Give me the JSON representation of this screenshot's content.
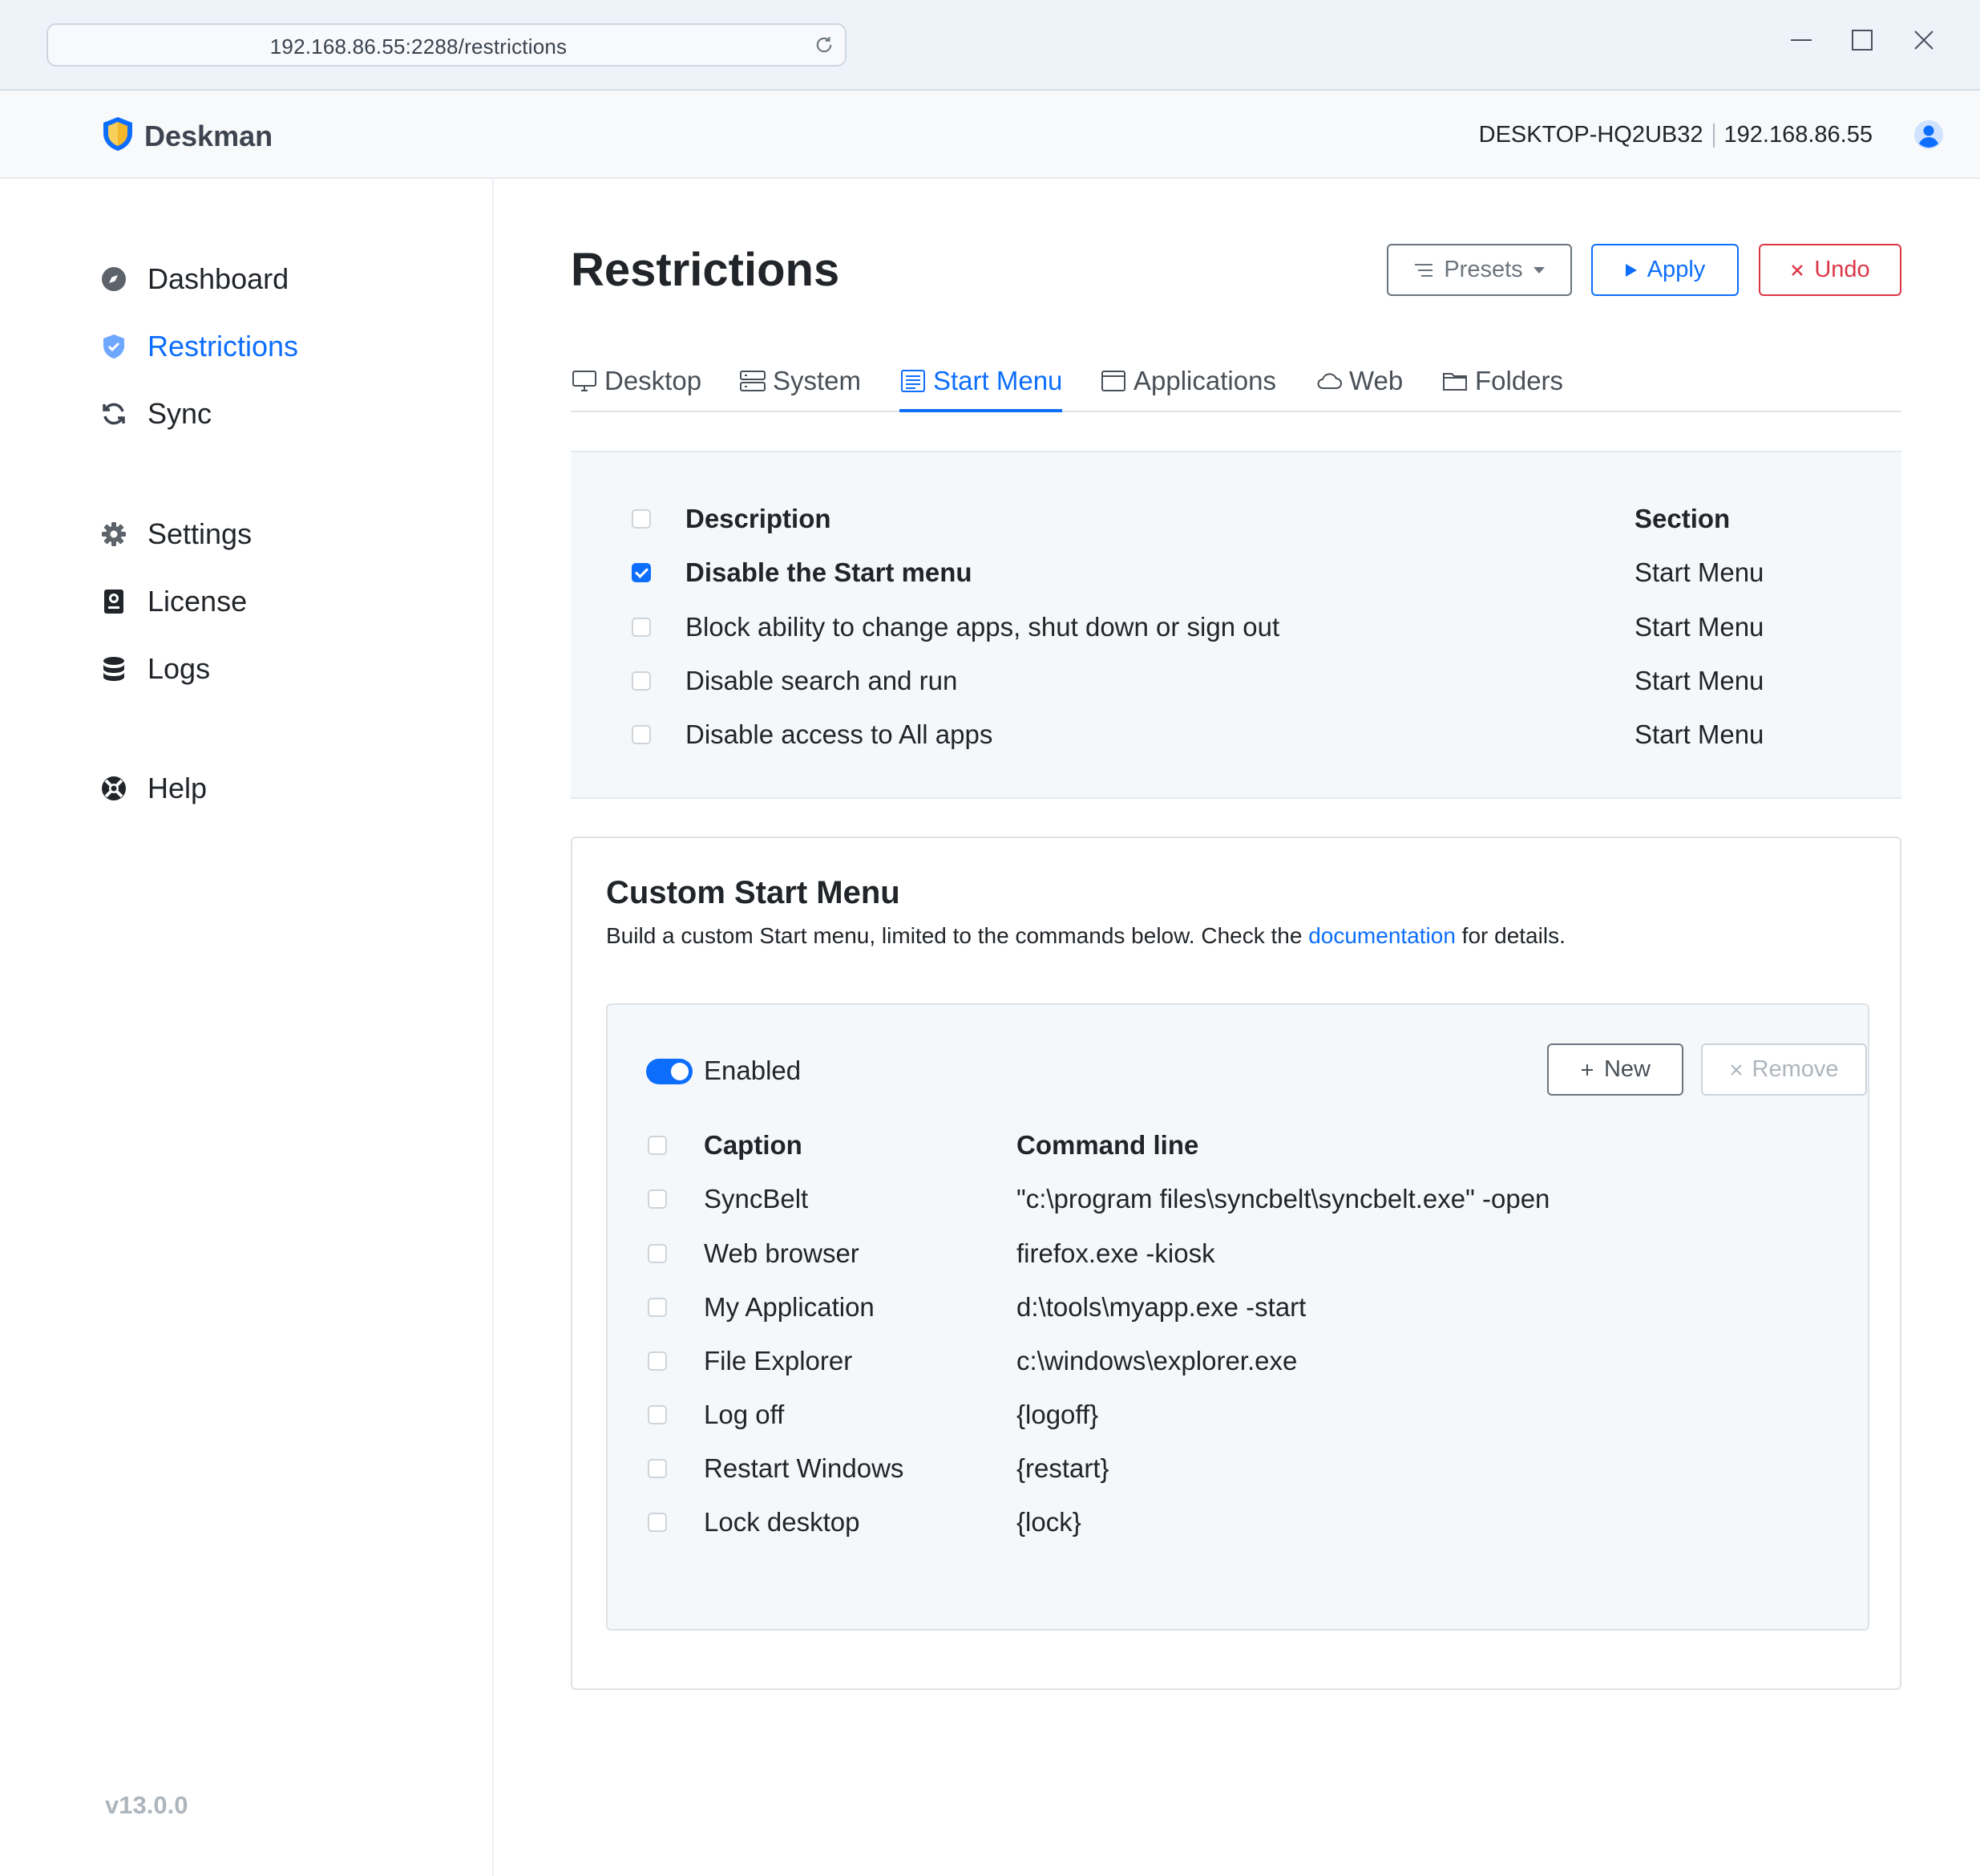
{
  "browser": {
    "url": "192.168.86.55:2288/restrictions"
  },
  "header": {
    "brand": "Deskman",
    "hostname": "DESKTOP-HQ2UB32",
    "ip": "192.168.86.55"
  },
  "sidebar": {
    "items": [
      {
        "label": "Dashboard",
        "icon": "compass-icon"
      },
      {
        "label": "Restrictions",
        "icon": "shield-check-icon",
        "active": true
      },
      {
        "label": "Sync",
        "icon": "sync-icon"
      },
      {
        "label": "Settings",
        "icon": "gear-icon"
      },
      {
        "label": "License",
        "icon": "license-icon"
      },
      {
        "label": "Logs",
        "icon": "database-icon"
      },
      {
        "label": "Help",
        "icon": "lifebuoy-icon"
      }
    ],
    "version": "v13.0.0"
  },
  "main": {
    "title": "Restrictions",
    "presets_label": "Presets",
    "apply_label": "Apply",
    "undo_label": "Undo",
    "tabs": [
      {
        "label": "Desktop",
        "icon": "monitor-icon"
      },
      {
        "label": "System",
        "icon": "server-icon"
      },
      {
        "label": "Start Menu",
        "icon": "start-menu-icon",
        "active": true
      },
      {
        "label": "Applications",
        "icon": "window-icon"
      },
      {
        "label": "Web",
        "icon": "cloud-icon"
      },
      {
        "label": "Folders",
        "icon": "folder-icon"
      }
    ],
    "restrictions": {
      "headers": {
        "description": "Description",
        "section": "Section"
      },
      "rows": [
        {
          "description": "Disable the Start menu",
          "section": "Start Menu",
          "checked": true
        },
        {
          "description": "Block ability to change apps, shut down or sign out",
          "section": "Start Menu",
          "checked": false
        },
        {
          "description": "Disable search and run",
          "section": "Start Menu",
          "checked": false
        },
        {
          "description": "Disable access to All apps",
          "section": "Start Menu",
          "checked": false
        }
      ]
    }
  },
  "custom_menu": {
    "title": "Custom Start Menu",
    "desc_before": "Build a custom Start menu, limited to the commands below. Check the ",
    "desc_link": "documentation",
    "desc_after": " for details.",
    "enabled_label": "Enabled",
    "enabled": true,
    "new_label": "New",
    "remove_label": "Remove",
    "headers": {
      "caption": "Caption",
      "command": "Command line"
    },
    "rows": [
      {
        "caption": "SyncBelt",
        "command": "\"c:\\program files\\syncbelt\\syncbelt.exe\" -open"
      },
      {
        "caption": "Web browser",
        "command": "firefox.exe -kiosk"
      },
      {
        "caption": "My Application",
        "command": "d:\\tools\\myapp.exe -start"
      },
      {
        "caption": "File Explorer",
        "command": "c:\\windows\\explorer.exe"
      },
      {
        "caption": "Log off",
        "command": "{logoff}"
      },
      {
        "caption": "Restart Windows",
        "command": "{restart}"
      },
      {
        "caption": "Lock desktop",
        "command": "{lock}"
      }
    ]
  },
  "colors": {
    "accent": "#0d6efd",
    "danger": "#dc3545",
    "muted": "#6c757d",
    "panel": "#f5f8fb"
  }
}
